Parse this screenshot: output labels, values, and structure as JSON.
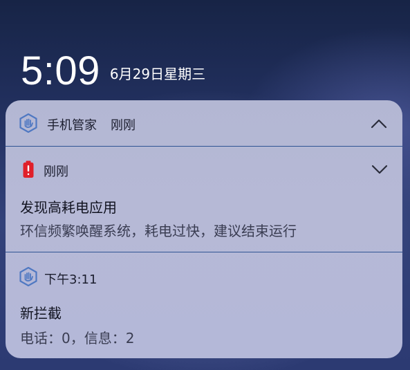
{
  "lockscreen": {
    "time": "5:09",
    "date": "6月29日星期三"
  },
  "notification_group": {
    "app_name": "手机管家",
    "time": "刚刚",
    "icon": "shield-hand-icon",
    "collapse_icon": "chevron-up-icon",
    "notifications": [
      {
        "icon": "battery-warning-icon",
        "time": "刚刚",
        "expand_icon": "chevron-down-icon",
        "title": "发现高耗电应用",
        "body": "环信频繁唤醒系统，耗电过快，建议结束运行"
      },
      {
        "icon": "shield-hand-icon",
        "time": "下午3:11",
        "title": "新拦截",
        "body": "电话：0，信息：2"
      }
    ]
  },
  "colors": {
    "card_background": "#b5b8d6",
    "divider": "#2e5393",
    "battery_red": "#e0202a"
  }
}
